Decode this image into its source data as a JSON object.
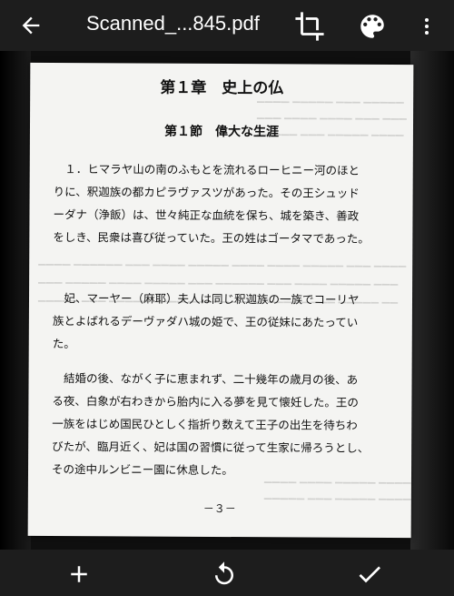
{
  "toolbar": {
    "title": "Scanned_...845.pdf",
    "back_icon": "arrow-left-icon",
    "crop_icon": "crop-icon",
    "palette_icon": "palette-icon",
    "more_icon": "more-vertical-icon"
  },
  "document": {
    "chapter_title": "第１章　史上の仏",
    "section_title": "第１節　偉大な生涯",
    "paragraph1": [
      "　１．ヒマラヤ山の南のふもとを流れるローヒニー河のほと",
      "りに、釈迦族の都カピラヴァスツがあった。その王シュッド",
      "ーダナ（浄飯）は、世々純正な血統を保ち、城を築き、善政",
      "をしき、民衆は喜び従っていた。王の姓はゴータマであった。"
    ],
    "paragraph2": [
      "　妃、マーヤー（麻耶）夫人は同じ釈迦族の一族でコーリヤ",
      "族とよばれるデーヴァダハ城の姫で、王の従妹にあたってい",
      "た。"
    ],
    "paragraph3": [
      "　結婚の後、ながく子に恵まれず、二十幾年の歳月の後、あ",
      "る夜、白象が右わきから胎内に入る夢を見て懐妊した。王の",
      "一族をはじめ国民ひとしく指折り数えて王子の出生を待ちわ",
      "びたが、臨月近く、妃は国の習慣に従って生家に帰ろうとし、",
      "その途中ルンビニー園に休息した。"
    ],
    "page_number": "－３－"
  },
  "bottom_bar": {
    "add_icon": "add-icon",
    "rotate_icon": "rotate-icon",
    "confirm_icon": "check-icon"
  },
  "colors": {
    "bar_background": "#1d1d1d",
    "icon_color": "#ffffff",
    "page_background": "#f4f4f2"
  }
}
